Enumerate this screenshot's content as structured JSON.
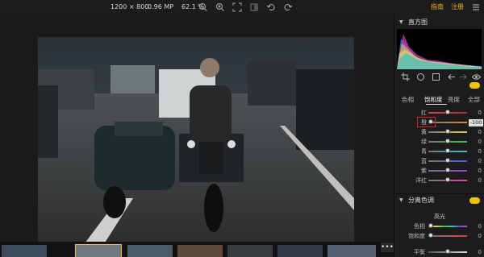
{
  "toolbar": {
    "dimensions": "1200 × 800",
    "megapixels": "0.96 MP",
    "zoom": "62.1 %",
    "link_guide": "指南",
    "link_register": "注册",
    "icons": [
      "zoom-out-icon",
      "zoom-in-icon",
      "fit-screen-icon",
      "compare-icon",
      "undo-icon",
      "redo-icon",
      "menu-icon"
    ]
  },
  "panel": {
    "histogram": {
      "title": "直方图"
    },
    "tabs": [
      {
        "label": "色相",
        "active": false
      },
      {
        "label": "饱和度",
        "active": true
      },
      {
        "label": "亮度",
        "active": false
      },
      {
        "label": "全部",
        "active": false
      }
    ],
    "hsl_sliders": [
      {
        "label": "红",
        "value": "0",
        "color": "#e04040"
      },
      {
        "label": "橙",
        "value": "-100",
        "color": "#e08a30"
      },
      {
        "label": "黄",
        "value": "0",
        "color": "#e0d040"
      },
      {
        "label": "绿",
        "value": "0",
        "color": "#40c040"
      },
      {
        "label": "青",
        "value": "0",
        "color": "#40c0c0"
      },
      {
        "label": "蓝",
        "value": "0",
        "color": "#4060e0"
      },
      {
        "label": "紫",
        "value": "0",
        "color": "#9040e0"
      },
      {
        "label": "洋红",
        "value": "0",
        "color": "#e040b0"
      }
    ],
    "split_toning": {
      "title": "分离色调",
      "highlights_label": "高光",
      "hue_label": "色相",
      "hue_value": "0",
      "sat_label": "饱和度",
      "sat_value": "0",
      "balance_label": "平衡",
      "balance_value": "0"
    },
    "accent_color": "#f0c400"
  }
}
